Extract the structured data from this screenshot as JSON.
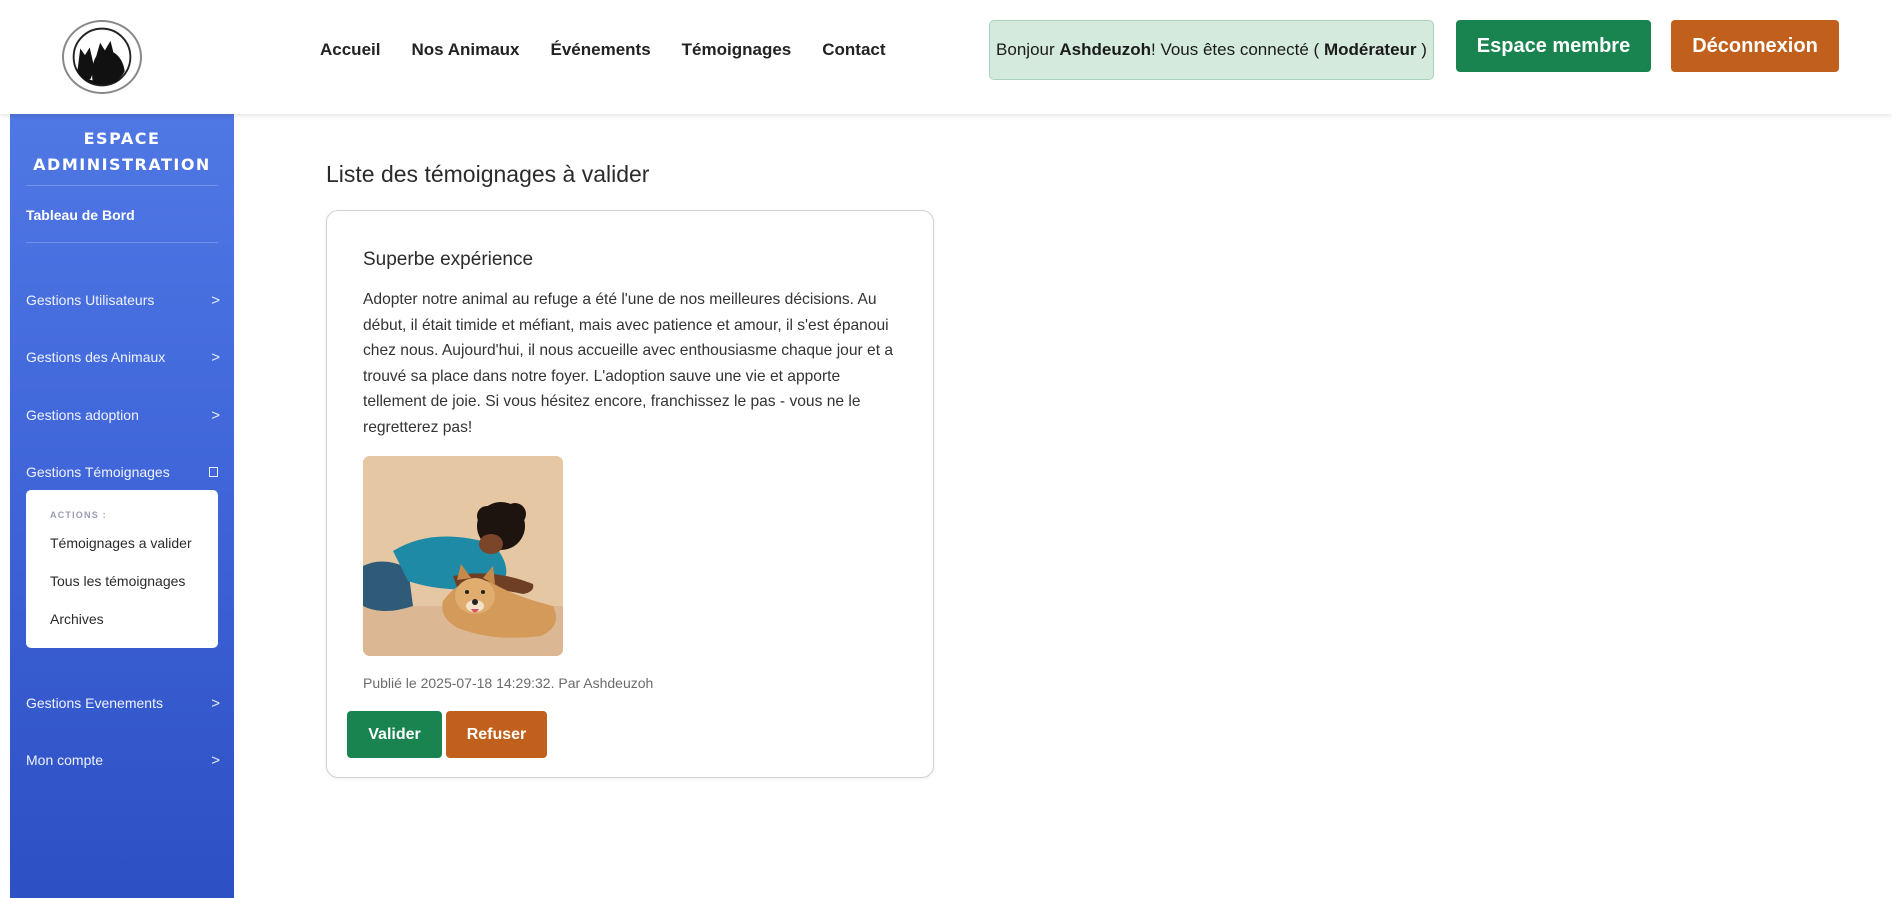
{
  "header": {
    "logo_icon": "cat-dog-silhouette-logo",
    "nav": [
      "Accueil",
      "Nos Animaux",
      "Événements",
      "Témoignages",
      "Contact"
    ],
    "welcome": {
      "prefix": "Bonjour ",
      "username": "Ashdeuzoh",
      "middle": " ! Vous êtes connecté ( ",
      "role": "Modérateur",
      "suffix": " )"
    },
    "member_button": "Espace membre",
    "logout_button": "Déconnexion"
  },
  "sidebar": {
    "title_line1": "ESPACE",
    "title_line2": "ADMINISTRATION",
    "dashboard": "Tableau de Bord",
    "items": [
      {
        "label": "Gestions Utilisateurs",
        "indicator": ">"
      },
      {
        "label": "Gestions des Animaux",
        "indicator": ">"
      },
      {
        "label": "Gestions adoption",
        "indicator": ">"
      },
      {
        "label": "Gestions Témoignages",
        "indicator": "expanded-square"
      },
      {
        "label": "Gestions Evenements",
        "indicator": ">"
      },
      {
        "label": "Mon compte",
        "indicator": ">"
      }
    ],
    "submenu": {
      "header": "ACTIONS :",
      "items": [
        "Témoignages a valider",
        "Tous les témoignages",
        "Archives"
      ]
    }
  },
  "main": {
    "page_title": "Liste des témoignages à valider",
    "testimonial": {
      "title": "Superbe expérience",
      "text": "Adopter notre animal au refuge a été l'une de nos meilleures décisions. Au début, il était timide et méfiant, mais avec patience et amour, il s'est épanoui chez nous. Aujourd'hui, il nous accueille avec enthousiasme chaque jour et a trouvé sa place dans notre foyer. L'adoption sauve une vie et apporte tellement de joie. Si vous hésitez encore, franchissez le pas - vous ne le regretterez pas!",
      "photo": "person-hugging-dog-photo",
      "meta": "Publié le 2025-07-18 14:29:32. Par Ashdeuzoh",
      "validate_button": "Valider",
      "refuse_button": "Refuser"
    }
  },
  "colors": {
    "green": "#1a8450",
    "orange": "#c0601c",
    "sidebar_top": "#5078e4",
    "sidebar_bottom": "#2d50c4",
    "welcome_bg": "#d3eadc"
  }
}
